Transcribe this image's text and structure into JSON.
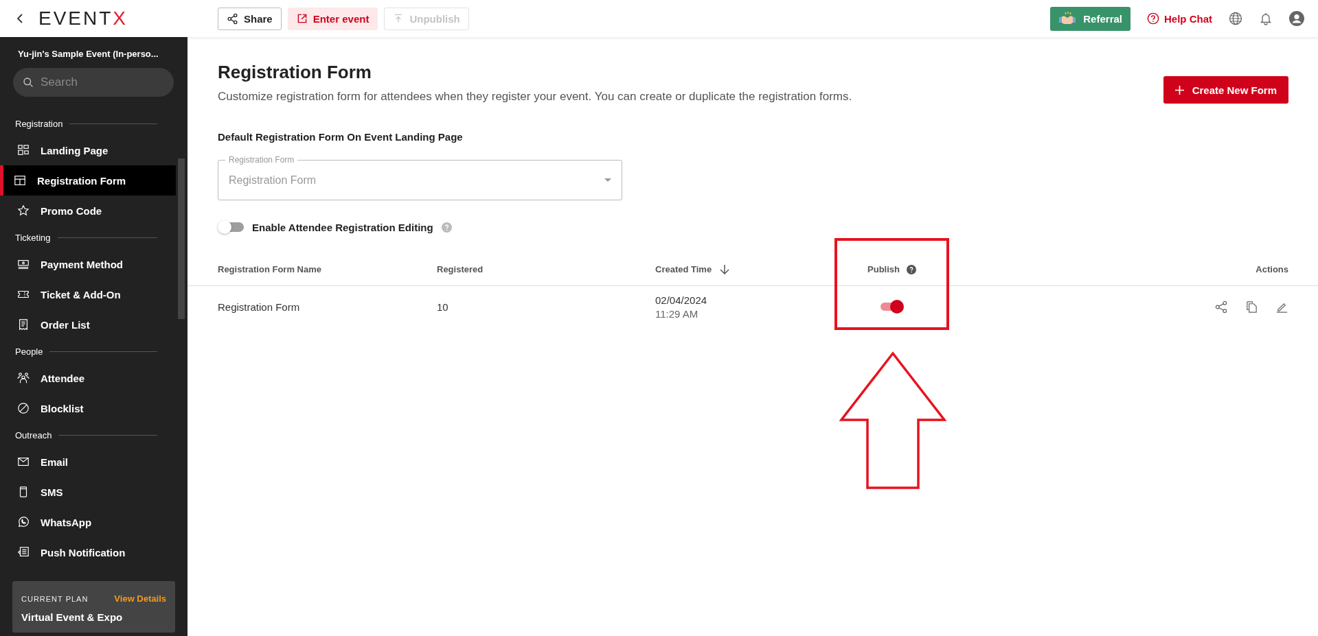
{
  "topbar": {
    "logo": {
      "text": "EVENT",
      "accent": "X"
    },
    "buttons": [
      {
        "label": "Share",
        "kind": "share",
        "disabled": false
      },
      {
        "label": "Enter event",
        "kind": "enter",
        "disabled": false
      },
      {
        "label": "Unpublish",
        "kind": "unpublish",
        "disabled": true
      }
    ],
    "referral": "Referral",
    "help_chat": "Help Chat"
  },
  "sidebar": {
    "event_title": "Yu-jin's Sample Event (In-perso...",
    "search": {
      "placeholder": "Search"
    },
    "sections": [
      {
        "title": "Registration",
        "items": [
          {
            "label": "Landing Page",
            "kind": "landing",
            "selected": false
          },
          {
            "label": "Registration Form",
            "kind": "form",
            "selected": true
          },
          {
            "label": "Promo Code",
            "kind": "promo",
            "selected": false
          }
        ]
      },
      {
        "title": "Ticketing",
        "items": [
          {
            "label": "Payment Method",
            "kind": "payment",
            "selected": false
          },
          {
            "label": "Ticket & Add-On",
            "kind": "ticket",
            "selected": false
          },
          {
            "label": "Order List",
            "kind": "orders",
            "selected": false
          }
        ]
      },
      {
        "title": "People",
        "items": [
          {
            "label": "Attendee",
            "kind": "attendee",
            "selected": false
          },
          {
            "label": "Blocklist",
            "kind": "block",
            "selected": false
          }
        ]
      },
      {
        "title": "Outreach",
        "items": [
          {
            "label": "Email",
            "kind": "email",
            "selected": false
          },
          {
            "label": "SMS",
            "kind": "sms",
            "selected": false
          },
          {
            "label": "WhatsApp",
            "kind": "whatsapp",
            "selected": false
          },
          {
            "label": "Push Notification",
            "kind": "push",
            "selected": false
          }
        ]
      }
    ],
    "plan": {
      "label": "CURRENT PLAN",
      "link": "View Details",
      "name": "Virtual Event & Expo"
    }
  },
  "main": {
    "title": "Registration Form",
    "description": "Customize registration form for attendees when they register your event. You can create or duplicate the registration forms.",
    "create_button": "Create New Form",
    "default_form": {
      "heading": "Default Registration Form On Event Landing Page",
      "select": {
        "label": "Registration Form",
        "value": "Registration Form"
      }
    },
    "editing_toggle": {
      "label": "Enable Attendee Registration Editing",
      "on": false
    },
    "table": {
      "columns": [
        "Registration Form Name",
        "Registered",
        "Created Time",
        "Publish",
        "Actions"
      ],
      "rows": [
        {
          "name": "Registration Form",
          "registered": "10",
          "created_date": "02/04/2024",
          "created_time": "11:29 AM",
          "published": true
        }
      ]
    }
  }
}
